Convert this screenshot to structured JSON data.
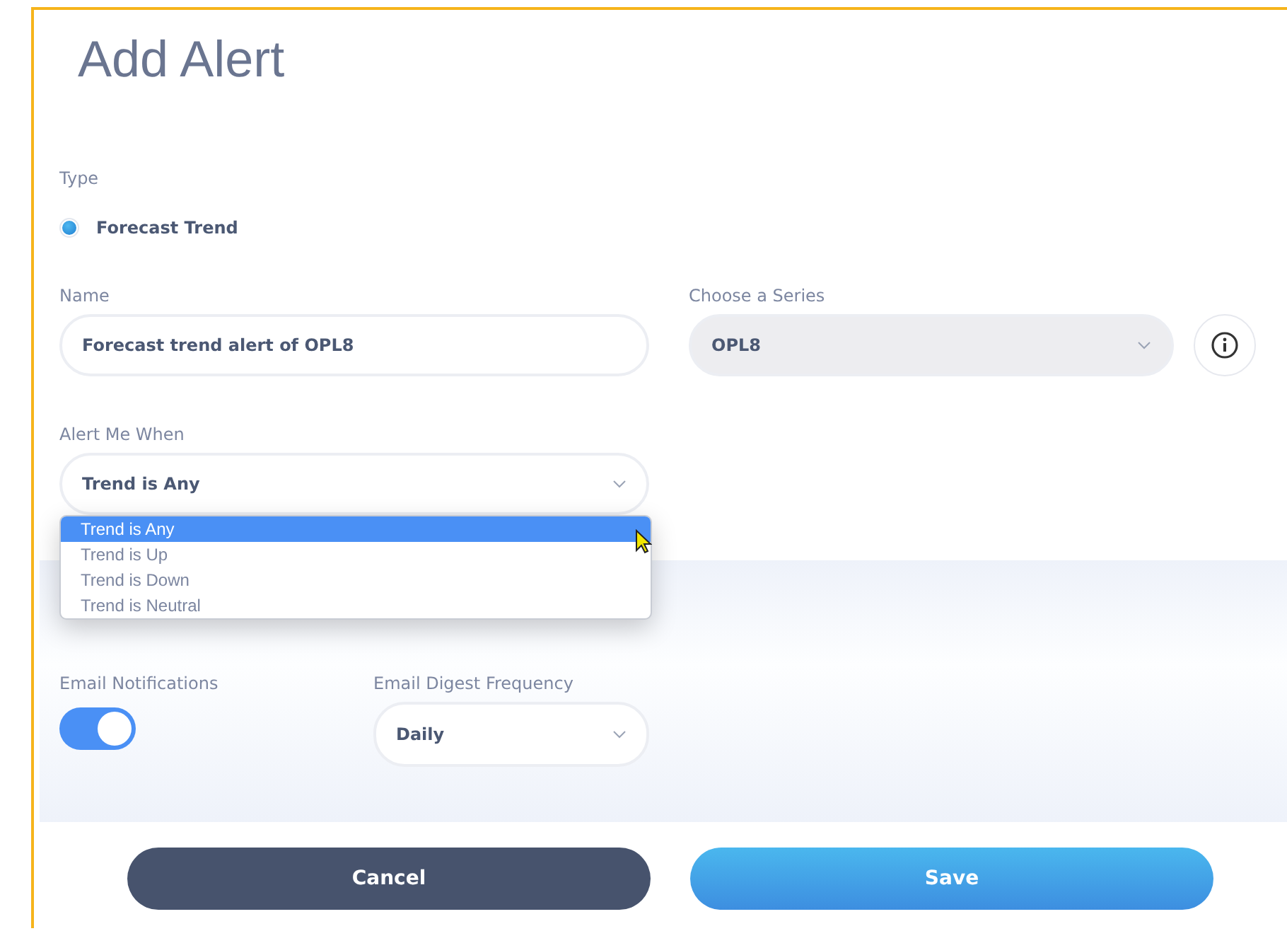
{
  "title": "Add Alert",
  "type": {
    "label": "Type",
    "options": [
      {
        "label": "Forecast Trend",
        "selected": true
      }
    ]
  },
  "name": {
    "label": "Name",
    "value": "Forecast trend alert of OPL8"
  },
  "series": {
    "label": "Choose a Series",
    "value": "OPL8",
    "disabled": true
  },
  "alert_when": {
    "label": "Alert Me When",
    "value": "Trend is Any",
    "expanded": true,
    "options": [
      {
        "label": "Trend is Any",
        "selected": true
      },
      {
        "label": "Trend is Up",
        "selected": false
      },
      {
        "label": "Trend is Down",
        "selected": false
      },
      {
        "label": "Trend is Neutral",
        "selected": false
      }
    ]
  },
  "email_notifications": {
    "label": "Email Notifications",
    "on": true
  },
  "digest": {
    "label": "Email Digest Frequency",
    "value": "Daily"
  },
  "buttons": [
    {
      "label": "Cancel",
      "kind": "secondary"
    },
    {
      "label": "Save",
      "kind": "primary"
    }
  ]
}
